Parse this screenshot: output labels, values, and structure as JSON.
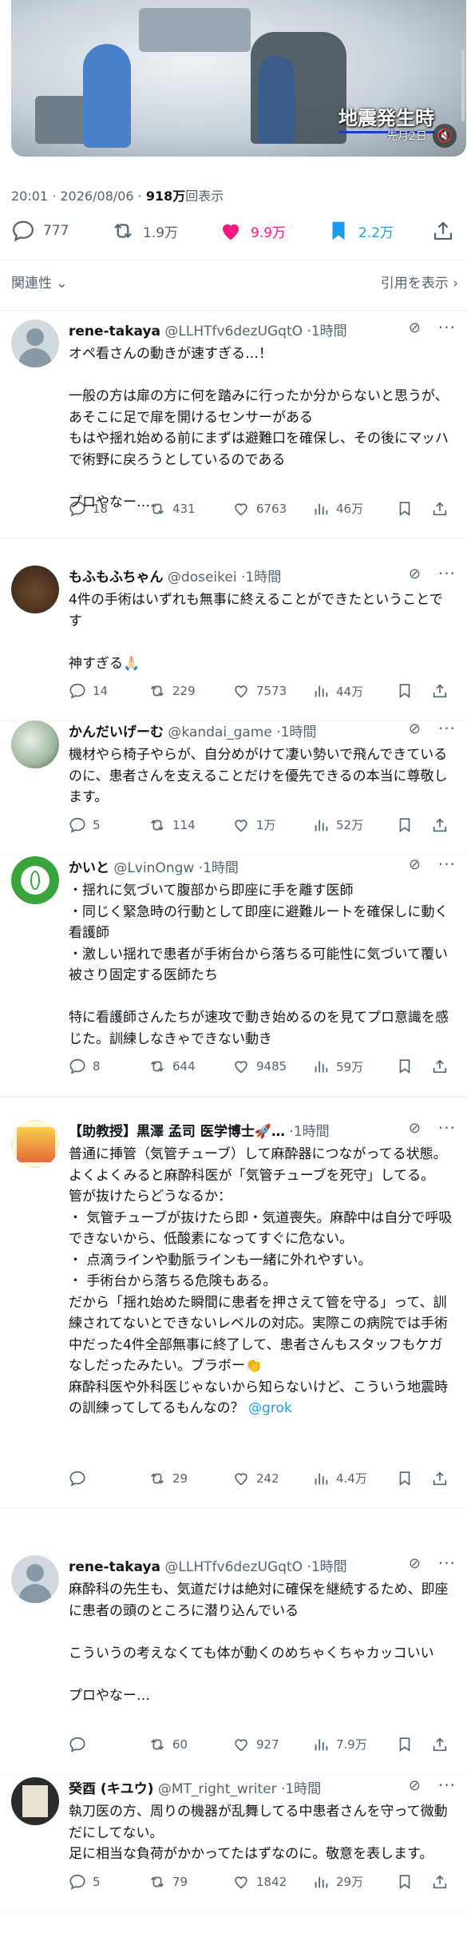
{
  "media": {
    "caption": "地震発生時",
    "subcaption": "先月2日"
  },
  "post_meta": {
    "time": "20:01",
    "sep": " · ",
    "date": "2026/08/06",
    "sep2": " · ",
    "views": "918万",
    "views_label": "回表示"
  },
  "stats": {
    "replies": "777",
    "reposts": "1.9万",
    "likes": "9.9万",
    "bookmarks": "2.2万",
    "like_color": "#f91880",
    "bookmark_color": "#1d9bf0"
  },
  "sort": {
    "relevance": "関連性",
    "quotes": "引用を表示"
  },
  "replies": [
    {
      "name": "rene-takaya",
      "handle": "@LLHTfv6dezUGqtO",
      "time": "1時間",
      "text": "オペ看さんの動きが速すぎる…！\n\n一般の方は扉の方に何を踏みに行ったか分からないと思うが、あそこに足で扉を開けるセンサーがある\nもはや揺れ始める前にまずは避難口を確保し、その後にマッハで術野に戻ろうとしているのである\n\nプロやなー…",
      "reply": "18",
      "repost": "431",
      "like": "6763",
      "views": "46万"
    },
    {
      "name": "もふもふちゃん",
      "handle": "@doseikei",
      "time": "1時間",
      "text": "4件の手術はいずれも無事に終えることができたということです\n\n神すぎる🙏🏻",
      "reply": "14",
      "repost": "229",
      "like": "7573",
      "views": "44万"
    },
    {
      "name": "かんだいげーむ",
      "handle": "@kandai_game",
      "time": "1時間",
      "text": "機材やら椅子やらが、自分めがけて凄い勢いで飛んできているのに、患者さんを支えることだけを優先できるの本当に尊敬します。",
      "reply": "5",
      "repost": "114",
      "like": "1万",
      "views": "52万"
    },
    {
      "name": "かいと",
      "handle": "@LvinOngw",
      "time": "1時間",
      "text": "・揺れに気づいて腹部から即座に手を離す医師\n・同じく緊急時の行動として即座に避難ルートを確保しに動く看護師\n・激しい揺れで患者が手術台から落ちる可能性に気づいて覆い被さり固定する医師たち\n\n特に看護師さんたちが速攻で動き始めるのを見てプロ意識を感じた。訓練しなきゃできない動き",
      "reply": "8",
      "repost": "644",
      "like": "9485",
      "views": "59万"
    },
    {
      "name": "【助教授】黒澤 孟司 医学博士🚀…",
      "handle": "",
      "time": "1時間",
      "text": "普通に挿管（気管チューブ）して麻酔器につながってる状態。よくよくみると麻酔科医が「気管チューブを死守」してる。\n管が抜けたらどうなるか：\n・ 気管チューブが抜けたら即・気道喪失。麻酔中は自分で呼吸できないから、低酸素になってすぐに危ない。\n・ 点滴ラインや動脈ラインも一緒に外れやすい。\n・ 手術台から落ちる危険もある。\nだから「揺れ始めた瞬間に患者を押さえて管を守る」って、訓練されてないとできないレベルの対応。実際この病院では手術中だった4件全部無事に終了して、患者さんもスタッフもケガなしだったみたい。ブラボー👏\n麻酔科医や外科医じゃないから知らないけど、こういう地震時の訓練ってしてるもんなの？ ",
      "link": "@grok",
      "reply": "",
      "repost": "29",
      "like": "242",
      "views": "4.4万"
    },
    {
      "name": "rene-takaya",
      "handle": "@LLHTfv6dezUGqtO",
      "time": "1時間",
      "text": "麻酔科の先生も、気道だけは絶対に確保を継続するため、即座に患者の頭のところに潜り込んでいる\n\nこういうの考えなくても体が動くのめちゃくちゃカッコいい\n\nプロやなー…",
      "reply": "",
      "repost": "60",
      "like": "927",
      "views": "7.9万"
    },
    {
      "name": "癸酉 (キユウ)",
      "handle": "@MT_right_writer",
      "time": "1時間",
      "text": "執刀医の方、周りの機器が乱舞してる中患者さんを守って微動だにしてない。\n足に相当な負荷がかかってたはずなのに。敬意を表します。",
      "reply": "5",
      "repost": "79",
      "like": "1842",
      "views": "29万"
    }
  ]
}
